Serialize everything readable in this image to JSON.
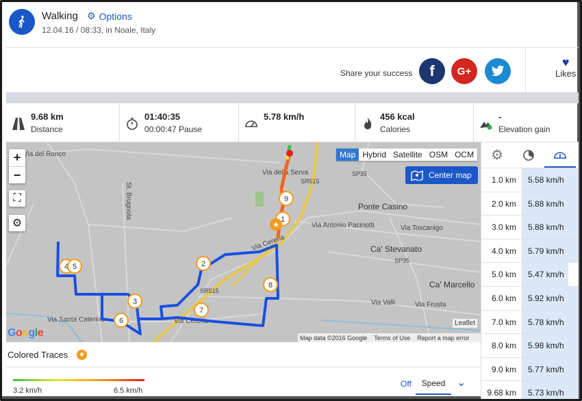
{
  "header": {
    "activity": "Walking",
    "options_label": "Options",
    "subtitle": "12.04.16 / 08:33, in Noale, Italy"
  },
  "share": {
    "label": "Share your success",
    "facebook": "f",
    "googleplus": "G+",
    "likes_label": "Likes"
  },
  "stats": [
    {
      "value": "9.68 km",
      "label": "Distance",
      "icon": "road-icon"
    },
    {
      "value": "01:40:35",
      "label": "00:00:47 Pause",
      "icon": "stopwatch-icon"
    },
    {
      "value": "5.78 km/h",
      "label": "",
      "icon": "speedometer-icon"
    },
    {
      "value": "456 kcal",
      "label": "Calories",
      "icon": "flame-icon"
    },
    {
      "value": "-",
      "label": "Elevation gain",
      "icon": "mountain-icon"
    }
  ],
  "map": {
    "layers": [
      "Map",
      "Hybrid",
      "Satellite",
      "OSM",
      "OCM"
    ],
    "active_layer": "Map",
    "center_map_label": "Center map",
    "leaflet": "Leaflet",
    "attribution": [
      "Map data ©2016 Google",
      "Terms of Use",
      "Report a map error"
    ],
    "google_logo": "Google",
    "place_labels": [
      "Via del Ronco",
      "Via della Serva",
      "SR515",
      "SP35",
      "Ponte Casino",
      "Via Antonio Pacinotti",
      "Via Toscanigo",
      "Ca' Stevanato",
      "SP35",
      "Ca' Marcello",
      "Via Valli",
      "Via Frusta",
      "Via Santa Caterina",
      "SR515",
      "St. Brugnola",
      "Via Cereria",
      "Via Cereria"
    ],
    "km_markers": [
      "1",
      "2",
      "3",
      "4",
      "5",
      "6",
      "7",
      "8",
      "9"
    ]
  },
  "traces": {
    "label": "Colored Traces",
    "min_label": "3.2 km/h",
    "max_label": "6.5 km/h",
    "off_label": "Off",
    "mode_label": "Speed",
    "colors": [
      "#39c54a",
      "#e8e42c",
      "#f39a1a",
      "#e32019"
    ]
  },
  "splits": {
    "rows": [
      {
        "km": "1.0 km",
        "speed": "5.58 km/h",
        "fill": 1.0
      },
      {
        "km": "2.0 km",
        "speed": "5.88 km/h",
        "fill": 1.0
      },
      {
        "km": "3.0 km",
        "speed": "5.88 km/h",
        "fill": 1.0
      },
      {
        "km": "4.0 km",
        "speed": "5.79 km/h",
        "fill": 1.0
      },
      {
        "km": "5.0 km",
        "speed": "5.47 km/h",
        "fill": 0.82
      },
      {
        "km": "6.0 km",
        "speed": "5.92 km/h",
        "fill": 1.0
      },
      {
        "km": "7.0 km",
        "speed": "5.78 km/h",
        "fill": 1.0
      },
      {
        "km": "8.0 km",
        "speed": "5.98 km/h",
        "fill": 1.0
      },
      {
        "km": "9.0 km",
        "speed": "5.77 km/h",
        "fill": 1.0
      },
      {
        "km": "9.68 km",
        "speed": "5.73 km/h",
        "fill": 1.0
      }
    ]
  },
  "colors": {
    "brand": "#1a57c8",
    "route": "#1a4fe0",
    "marker": "#f39a1a"
  }
}
